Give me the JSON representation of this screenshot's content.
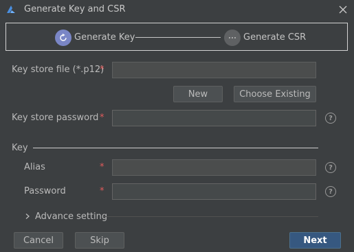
{
  "window": {
    "title": "Generate Key and CSR"
  },
  "colors": {
    "background": "#3c3f41",
    "accent": "#365880",
    "step_active": "#7a86c6",
    "required": "#e05b5b"
  },
  "stepper": {
    "steps": [
      {
        "label": "Generate Key",
        "icon": "refresh-icon",
        "state": "active"
      },
      {
        "label": "Generate CSR",
        "icon": "ellipsis-icon",
        "state": "pending"
      }
    ]
  },
  "keystore": {
    "file_label": "Key store file (*.p12)",
    "file_value": "",
    "required_mark": "*",
    "new_label": "New",
    "choose_existing_label": "Choose Existing",
    "password_label": "Key store password",
    "password_value": ""
  },
  "key": {
    "section_label": "Key",
    "alias_label": "Alias",
    "alias_value": "",
    "password_label": "Password",
    "password_value": ""
  },
  "advanced": {
    "label": "Advance setting",
    "icon": "chevron-right-icon"
  },
  "help": {
    "glyph": "?"
  },
  "footer": {
    "cancel_label": "Cancel",
    "skip_label": "Skip",
    "next_label": "Next"
  }
}
